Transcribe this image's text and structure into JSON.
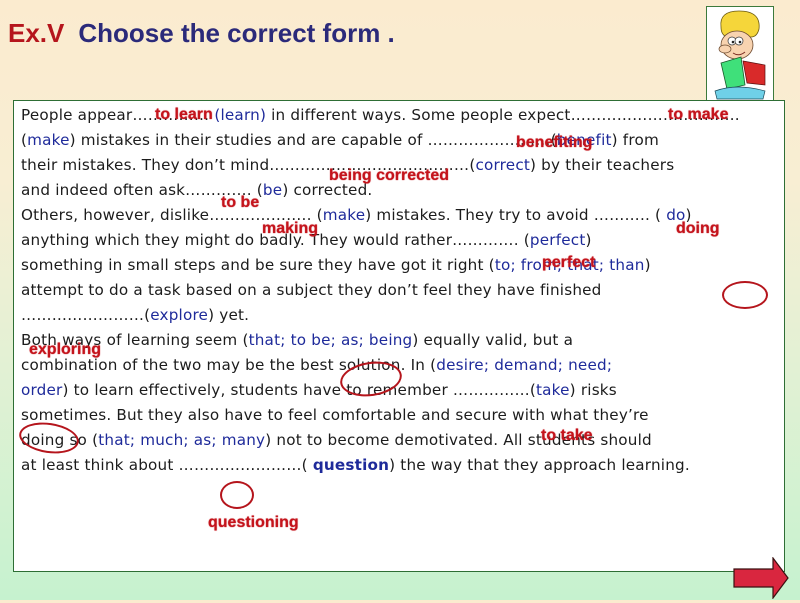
{
  "header": {
    "exercise_label": "Ex.V",
    "instruction": "Choose the correct form ."
  },
  "illustration": {
    "icon": "boy-reading-book-icon"
  },
  "exercise": {
    "lines": [
      [
        {
          "t": "People appear……………  "
        },
        {
          "t": "(learn)",
          "o": 1
        },
        {
          "t": " in different ways. Some people expect……………………………"
        }
      ],
      [
        {
          "t": "(",
          "o": 0
        },
        {
          "t": "make",
          "o": 1
        },
        {
          "t": ") mistakes in their studies and  are capable of ……………………("
        },
        {
          "t": "benefit",
          "o": 1
        },
        {
          "t": ") from"
        }
      ],
      [
        {
          "t": "their mistakes. They don’t mind…………………………………("
        },
        {
          "t": "correct",
          "o": 1
        },
        {
          "t": ") by their teachers"
        }
      ],
      [
        {
          "t": "and indeed often ask…………. ("
        },
        {
          "t": "be",
          "o": 1
        },
        {
          "t": ") corrected."
        }
      ],
      [
        {
          "t": "Others, however, dislike……………….. ("
        },
        {
          "t": "make",
          "o": 1
        },
        {
          "t": ") mistakes. They try to avoid ……….. ( "
        },
        {
          "t": "do",
          "o": 1
        },
        {
          "t": ")"
        }
      ],
      [
        {
          "t": "anything which they might do badly. They would rather………….     ("
        },
        {
          "t": "perfect",
          "o": 1
        },
        {
          "t": ")"
        }
      ],
      [
        {
          "t": "something in small steps and be sure they have got it right ("
        },
        {
          "t": "to; from; that; than",
          "o": 1
        },
        {
          "t": ")"
        }
      ],
      [
        {
          "t": "attempt to do a task based on a subject they don’t feel they have finished"
        }
      ],
      [
        {
          "t": "……………………("
        },
        {
          "t": "explore",
          "o": 1
        },
        {
          "t": ") yet."
        }
      ],
      [
        {
          "t": "Both ways of learning seem ("
        },
        {
          "t": "that; to be; as; being",
          "o": 1
        },
        {
          "t": ") equally valid, but a"
        }
      ],
      [
        {
          "t": "combination of the two may be the best solution. In ("
        },
        {
          "t": "desire; demand; need;",
          "o": 1
        }
      ],
      [
        {
          "t": "order",
          "o": 1
        },
        {
          "t": ") to learn effectively, students have to remember ……………("
        },
        {
          "t": "take",
          "o": 1
        },
        {
          "t": ") risks"
        }
      ],
      [
        {
          "t": "sometimes. But they also have to feel comfortable and secure with what they’re"
        }
      ],
      [
        {
          "t": "doing so ("
        },
        {
          "t": "that; much; as; many",
          "o": 1
        },
        {
          "t": ") not to become demotivated. All students should"
        }
      ],
      [
        {
          "t": "at least think about ……………………( "
        },
        {
          "t": "question",
          "o": 2
        },
        {
          "t": ") the way that they approach learning."
        }
      ]
    ]
  },
  "answers": {
    "to_learn": "to learn",
    "to_make": "to make",
    "benefiting": "benefiting",
    "being_corrected": "being corrected",
    "to_be": "to be",
    "making": "making",
    "doing": "doing",
    "perfect": "perfect",
    "exploring": "exploring",
    "to_take": "to take",
    "questioning": "questioning"
  },
  "navigation": {
    "next_icon": "next-arrow-icon"
  },
  "colors": {
    "title_exercise": "#b5151c",
    "title_text": "#2b2a7a",
    "option_text": "#1e2a9a",
    "answer_text": "#c4141c",
    "arrow_fill": "#d9263f"
  }
}
